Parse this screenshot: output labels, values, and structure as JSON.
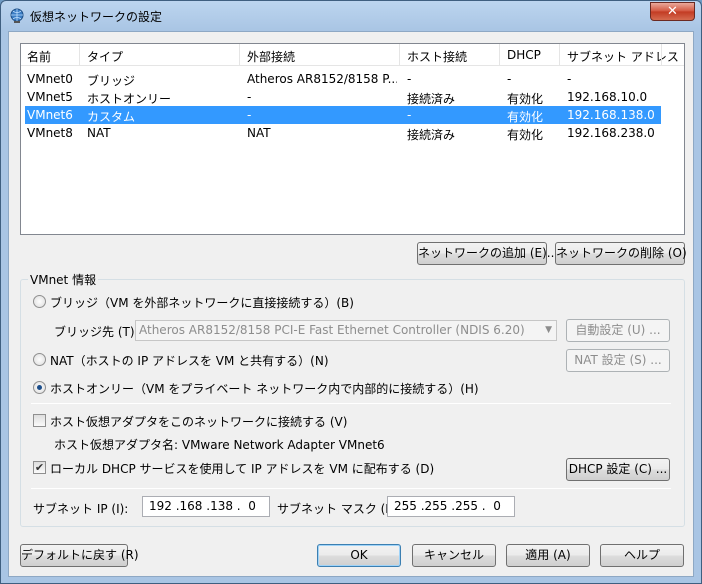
{
  "window": {
    "title": "仮想ネットワークの設定",
    "close_label": "✕"
  },
  "list": {
    "columns": [
      "名前",
      "タイプ",
      "外部接続",
      "ホスト接続",
      "DHCP",
      "サブネット アドレス"
    ],
    "rows": [
      {
        "name": "VMnet0",
        "type": "ブリッジ",
        "external": "Atheros AR8152/8158 P...",
        "host": "-",
        "dhcp": "-",
        "subnet": "-"
      },
      {
        "name": "VMnet5",
        "type": "ホストオンリー",
        "external": "-",
        "host": "接続済み",
        "dhcp": "有効化",
        "subnet": "192.168.10.0"
      },
      {
        "name": "VMnet6",
        "type": "カスタム",
        "external": "-",
        "host": "-",
        "dhcp": "有効化",
        "subnet": "192.168.138.0"
      },
      {
        "name": "VMnet8",
        "type": "NAT",
        "external": "NAT",
        "host": "接続済み",
        "dhcp": "有効化",
        "subnet": "192.168.238.0"
      }
    ],
    "selected_index": 2
  },
  "buttons": {
    "add_network": "ネットワークの追加 (E)...",
    "remove_network": "ネットワークの削除 (O)",
    "auto_settings": "自動設定 (U) ...",
    "nat_settings": "NAT 設定 (S) ...",
    "dhcp_settings": "DHCP 設定 (C) ...",
    "restore_defaults": "デフォルトに戻す (R)",
    "ok": "OK",
    "cancel": "キャンセル",
    "apply": "適用 (A)",
    "help": "ヘルプ"
  },
  "vmnet_info": {
    "group_label": "VMnet 情報",
    "bridge_label": "ブリッジ（VM を外部ネットワークに直接接続する）(B)",
    "bridge_to_label": "ブリッジ先 (T):",
    "bridge_to_value": "Atheros AR8152/8158 PCI-E Fast Ethernet Controller (NDIS 6.20)",
    "nat_label": "NAT（ホストの IP アドレスを VM と共有する）(N)",
    "hostonly_label": "ホストオンリー（VM をプライベート ネットワーク内で内部的に接続する）(H)",
    "selected_mode": "hostonly",
    "connect_adapter_label": "ホスト仮想アダプタをこのネットワークに接続する (V)",
    "connect_adapter_checked": false,
    "adapter_name_label": "ホスト仮想アダプタ名: VMware Network Adapter VMnet6",
    "dhcp_label": "ローカル DHCP サービスを使用して IP アドレスを VM に配布する (D)",
    "dhcp_checked": true,
    "subnet_ip_label": "サブネット IP (I):",
    "subnet_ip_value": "192 .168 .138 .  0",
    "subnet_mask_label": "サブネット マスク (M):",
    "subnet_mask_value": "255 .255 .255 .  0"
  }
}
